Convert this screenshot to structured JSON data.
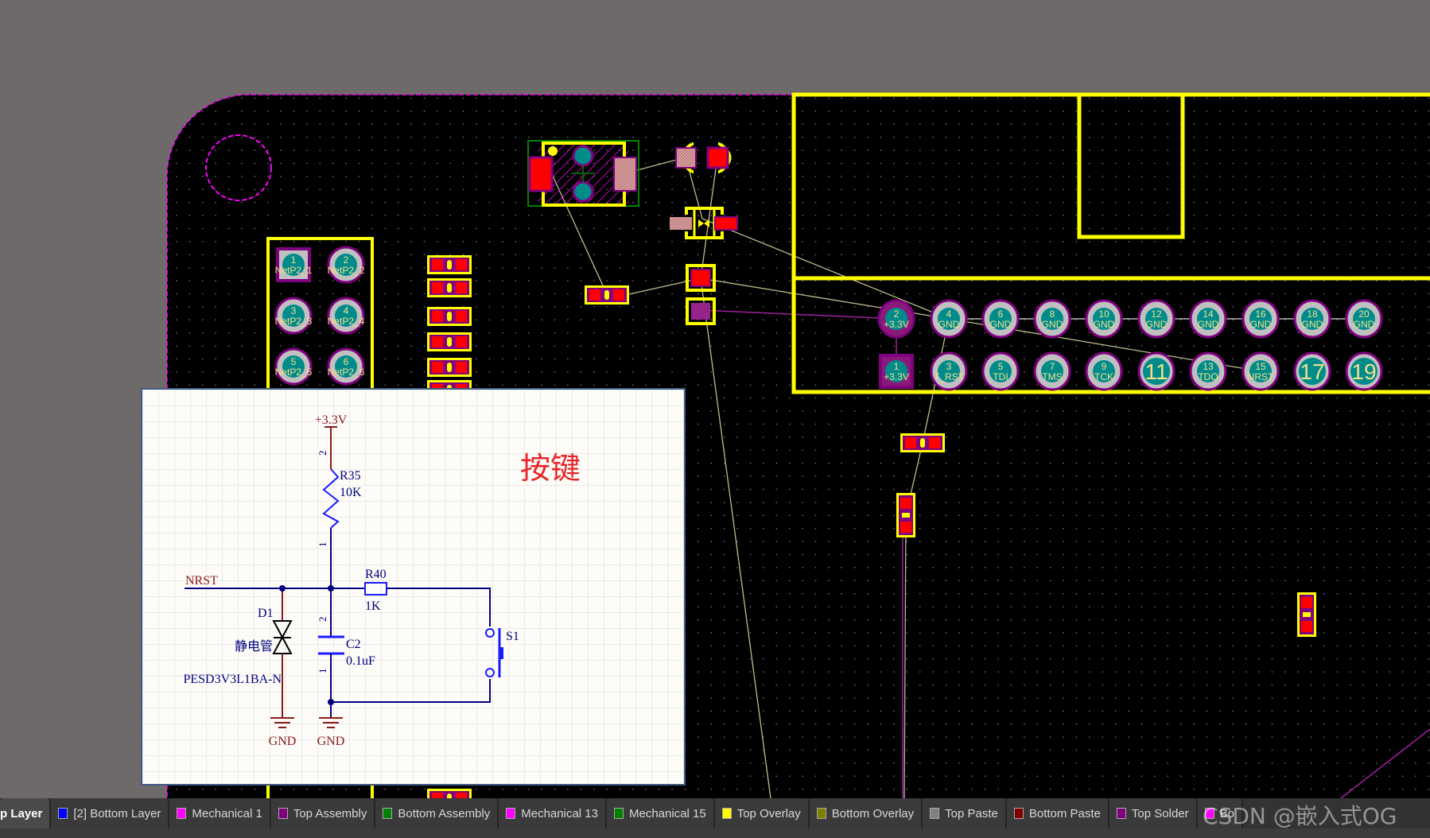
{
  "colors": {
    "board": "#000000",
    "outline": "#ff00ff",
    "overlay": "#ffff00",
    "pad_smd": "#ff0000",
    "pad_ring": "#800080",
    "pad_gray": "#c0c0c0",
    "hole": "#008b8b",
    "pad_text": "#f5e08a",
    "ratsnest": "#bdbd90"
  },
  "left_connector": {
    "pins": [
      {
        "num": "1",
        "net": "NetP2_1",
        "square": true
      },
      {
        "num": "2",
        "net": "NetP2_2"
      },
      {
        "num": "3",
        "net": "NetP2_3"
      },
      {
        "num": "4",
        "net": "NetP2_4"
      },
      {
        "num": "5",
        "net": "NetP2_5"
      },
      {
        "num": "6",
        "net": "NetP2_6"
      }
    ]
  },
  "header": {
    "top_row": [
      {
        "num": "2",
        "net": "+3.3V"
      },
      {
        "num": "4",
        "net": "GND"
      },
      {
        "num": "6",
        "net": "GND"
      },
      {
        "num": "8",
        "net": "GND"
      },
      {
        "num": "10",
        "net": "GND"
      },
      {
        "num": "12",
        "net": "GND"
      },
      {
        "num": "14",
        "net": "GND"
      },
      {
        "num": "16",
        "net": "GND"
      },
      {
        "num": "18",
        "net": "GND"
      },
      {
        "num": "20",
        "net": "GND"
      }
    ],
    "bottom_row": [
      {
        "num": "1",
        "net": "+3.3V"
      },
      {
        "num": "3",
        "net": "T_RST"
      },
      {
        "num": "5",
        "net": "TDI"
      },
      {
        "num": "7",
        "net": "TMS"
      },
      {
        "num": "9",
        "net": "TCK"
      },
      {
        "num": "11",
        "net": ""
      },
      {
        "num": "13",
        "net": "TDO"
      },
      {
        "num": "15",
        "net": "NRST"
      },
      {
        "num": "17",
        "net": ""
      },
      {
        "num": "19",
        "net": ""
      }
    ]
  },
  "schematic": {
    "title": "按键",
    "vcc": "+3.3V",
    "net_nrst": "NRST",
    "r35": {
      "ref": "R35",
      "value": "10K",
      "pin_top": "2",
      "pin_bottom": "1"
    },
    "r40": {
      "ref": "R40",
      "value": "1K"
    },
    "c2": {
      "ref": "C2",
      "value": "0.1uF",
      "pin_top": "2",
      "pin_bottom": "1"
    },
    "d1": {
      "ref": "D1",
      "desc": "静电管",
      "part": "PESD3V3L1BA-N"
    },
    "s1": {
      "ref": "S1"
    },
    "gnd1": "GND",
    "gnd2": "GND"
  },
  "layer_tabs": [
    {
      "label": "p Layer",
      "active": true
    },
    {
      "label": "[2] Bottom Layer",
      "color": "#0000ff"
    },
    {
      "label": "Mechanical 1",
      "color": "#ff00ff"
    },
    {
      "label": "Top Assembly",
      "color": "#800080"
    },
    {
      "label": "Bottom Assembly",
      "color": "#008000"
    },
    {
      "label": "Mechanical 13",
      "color": "#ff00ff"
    },
    {
      "label": "Mechanical 15",
      "color": "#008000"
    },
    {
      "label": "Top Overlay",
      "color": "#ffff00"
    },
    {
      "label": "Bottom Overlay",
      "color": "#808000"
    },
    {
      "label": "Top Paste",
      "color": "#808080"
    },
    {
      "label": "Bottom Paste",
      "color": "#800000"
    },
    {
      "label": "Top Solder",
      "color": "#800080"
    },
    {
      "label": "Bo",
      "color": "#ff00ff"
    }
  ],
  "watermark": "CSDN @嵌入式OG"
}
